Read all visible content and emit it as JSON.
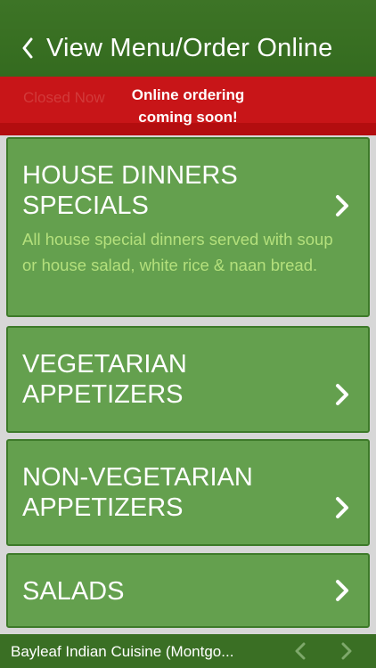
{
  "header": {
    "title": "View Menu/Order Online"
  },
  "banner": {
    "ghost_label": "Closed Now",
    "message_line1": "Online ordering",
    "message_line2": "coming soon!"
  },
  "categories": [
    {
      "title": "HOUSE DINNERS\nSPECIALS",
      "description": "All house special dinners served with soup or house salad, white rice & naan bread."
    },
    {
      "title": "VEGETARIAN\nAPPETIZERS",
      "description": ""
    },
    {
      "title": "NON-VEGETARIAN\nAPPETIZERS",
      "description": ""
    },
    {
      "title": "SALADS",
      "description": ""
    }
  ],
  "footer": {
    "restaurant_name": "Bayleaf Indian Cuisine (Montgo..."
  },
  "colors": {
    "header_green": "#3d7426",
    "card_green": "#64a04e",
    "banner_red": "#b30d0f",
    "description_text": "#b4e07c"
  },
  "icons": [
    "back-chevron-icon",
    "chevron-right-icon",
    "prev-arrow-icon",
    "next-arrow-icon"
  ]
}
